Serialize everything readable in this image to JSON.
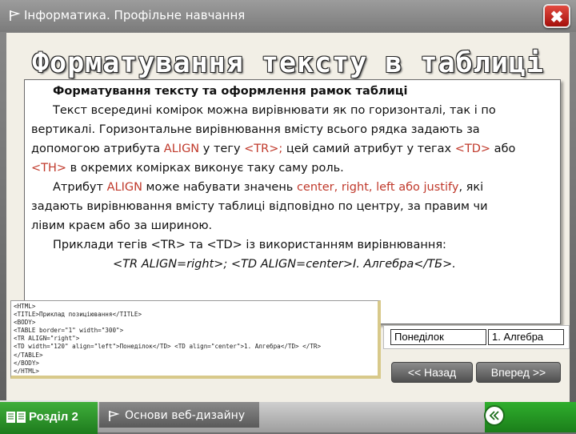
{
  "window": {
    "title": "Інформатика. Профільне навчання",
    "close_label": "✖"
  },
  "slide": {
    "heading": "Форматування тексту в таблиці",
    "subheading": "Форматування тексту та оформлення рамок таблиці",
    "p1": {
      "l1": "Текст всередині комірок можна вирівнювати як по горизонталі, так і по",
      "l2": "вертикалі. Горизонтальне вирівнювання вмісту всього рядка задають за",
      "l3a": "допомогою атрибута ",
      "l3b": "ALIGN",
      "l3c": " у тегу ",
      "l3d": "<TR>;",
      "l3e": " цей самий атрибут у тегах ",
      "l3f": "<TD>",
      "l3g": " або",
      "l4a": "<TH>",
      "l4b": " в окремих комірках виконує таку саму роль."
    },
    "p2": {
      "l1a": "Атрибут ",
      "l1b": "ALIGN",
      "l1c": " може набувати значень ",
      "l1d": "center, right, left або justify",
      "l1e": ", які",
      "l2": "задають вирівнювання вмісту таблиці відповідно по центру, за правим чи",
      "l3": "лівим краєм або за шириною."
    },
    "p3": "Приклади тегів <TR> та <TD> із використанням вирівнювання:",
    "example": "<TR ALIGN=right>; <TD ALIGN=center>І. Алгебра</ТБ>.",
    "code_lines": [
      "<HTML>",
      "<TITLE>Приклад позиціювання</TITLE>",
      "<BODY>",
      "<TABLE border=\"1\" width=\"300\">",
      "<TR ALIGN=\"right\">",
      "<TD width=\"120\" align=\"left\">Понеділок</TD> <TD align=\"center\">1. Алгебра</TD> </TR>",
      "</TABLE>",
      "</BODY>",
      "</HTML>"
    ],
    "table_demo": {
      "cell1": "Понеділок",
      "cell2": "1. Алгебра"
    }
  },
  "nav": {
    "back_label": "<< Назад",
    "forward_label": "Вперед >>"
  },
  "bottom": {
    "section_label": "Розділ 2",
    "topic_label": "Основи веб-дизайну",
    "back_icon": "chevron-left-icon"
  }
}
